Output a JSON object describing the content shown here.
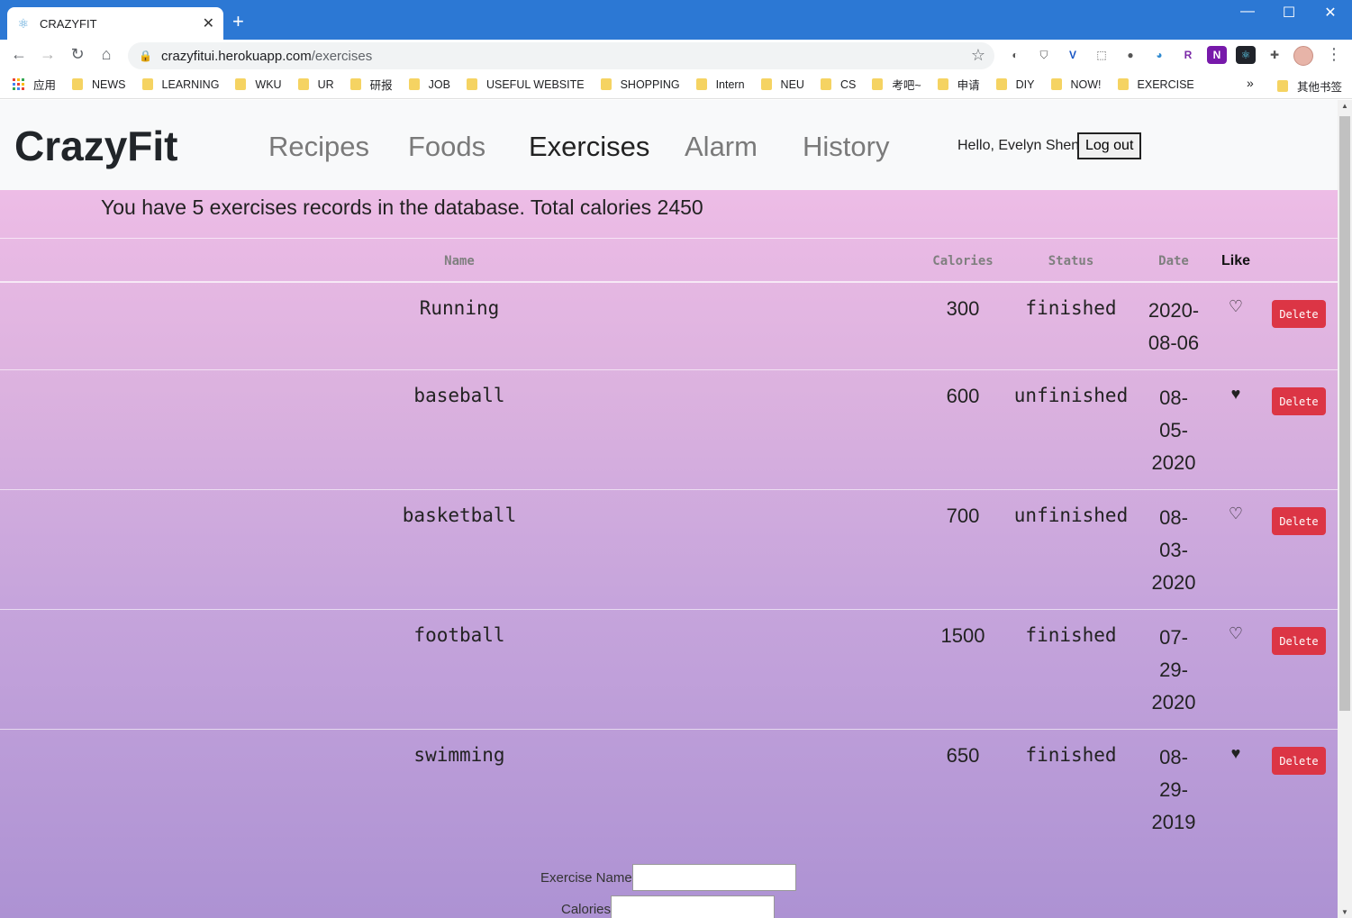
{
  "browser": {
    "tab_title": "CRAZYFIT",
    "url_host": "crazyfitui.herokuapp.com",
    "url_path": "/exercises",
    "bookmarks": [
      "应用",
      "NEWS",
      "LEARNING",
      "WKU",
      "UR",
      "研报",
      "JOB",
      "USEFUL WEBSITE",
      "SHOPPING",
      "Intern",
      "NEU",
      "CS",
      "考吧~",
      "申请",
      "DIY",
      "NOW!",
      "EXERCISE"
    ],
    "bookmarks_more": "»",
    "other_bookmarks": "其他书签"
  },
  "app": {
    "brand": "CrazyFit",
    "nav": [
      "Recipes",
      "Foods",
      "Exercises",
      "Alarm",
      "History"
    ],
    "active_nav": "Exercises",
    "greeting": "Hello, Evelyn Shen",
    "logout_label": "Log out",
    "summary": "You have 5 exercises records in the database. Total calories 2450"
  },
  "table": {
    "headers": {
      "name": "Name",
      "calories": "Calories",
      "status": "Status",
      "date": "Date",
      "like": "Like"
    },
    "delete_label": "Delete",
    "rows": [
      {
        "name": "Running",
        "calories": "300",
        "status": "finished",
        "date_lines": [
          "2020-",
          "08-06"
        ],
        "liked": false
      },
      {
        "name": "baseball",
        "calories": "600",
        "status": "unfinished",
        "date_lines": [
          "08-",
          "05-",
          "2020"
        ],
        "liked": true
      },
      {
        "name": "basketball",
        "calories": "700",
        "status": "unfinished",
        "date_lines": [
          "08-",
          "03-",
          "2020"
        ],
        "liked": false
      },
      {
        "name": "football",
        "calories": "1500",
        "status": "finished",
        "date_lines": [
          "07-",
          "29-",
          "2020"
        ],
        "liked": false
      },
      {
        "name": "swimming",
        "calories": "650",
        "status": "finished",
        "date_lines": [
          "08-",
          "29-",
          "2019"
        ],
        "liked": true
      }
    ]
  },
  "form": {
    "exercise_name_label": "Exercise Name",
    "calories_label": "Calories"
  },
  "icons": {
    "heart_empty": "heart-outline-icon",
    "heart_filled": "heart-filled-icon"
  },
  "colors": {
    "delete": "#dc3545",
    "titlebar": "#2c78d4",
    "gradient_top": "#f5c1e9",
    "gradient_bottom": "#ad92d3"
  }
}
